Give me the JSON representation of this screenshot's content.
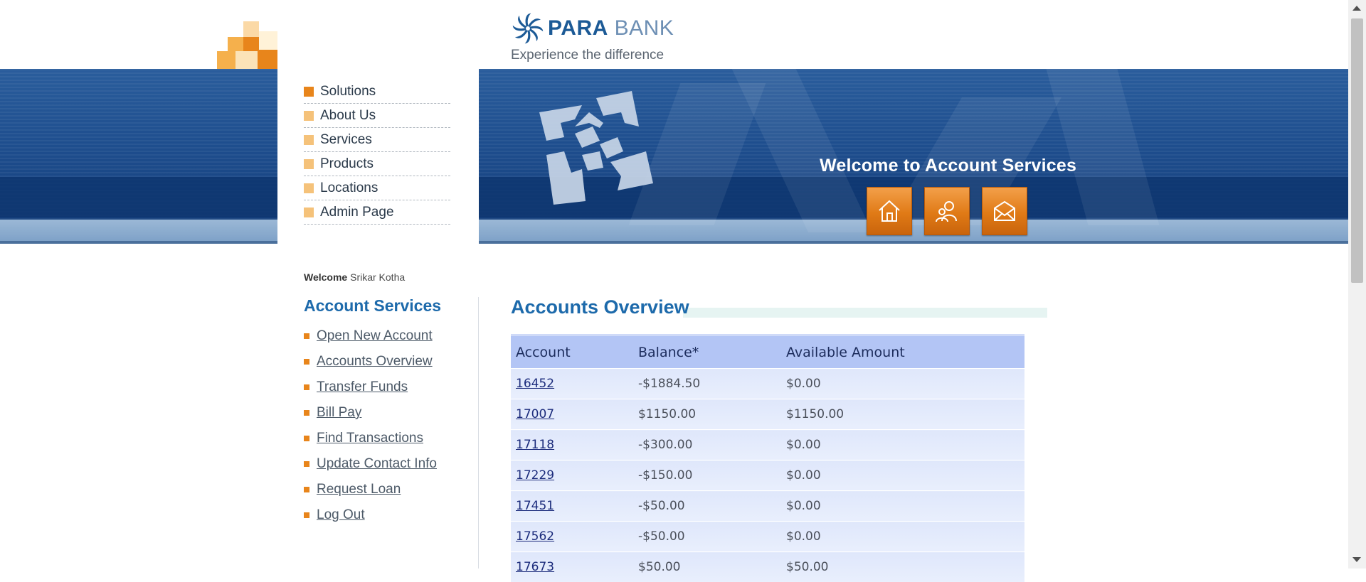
{
  "brand": {
    "name_bold": "PARA",
    "name_thin": " BANK",
    "tagline": "Experience the difference"
  },
  "top_nav": [
    {
      "label": "Solutions",
      "active": true
    },
    {
      "label": "About Us",
      "active": false
    },
    {
      "label": "Services",
      "active": false
    },
    {
      "label": "Products",
      "active": false
    },
    {
      "label": "Locations",
      "active": false
    },
    {
      "label": "Admin Page",
      "active": false
    }
  ],
  "header": {
    "welcome_title": "Welcome to Account Services",
    "buttons": [
      {
        "icon": "home-icon"
      },
      {
        "icon": "about-people-icon"
      },
      {
        "icon": "contact-envelope-icon"
      }
    ]
  },
  "sidebar": {
    "welcome_label": "Welcome",
    "user_name": "Srikar Kotha",
    "title": "Account Services",
    "links": [
      "Open New Account",
      "Accounts Overview",
      "Transfer Funds",
      "Bill Pay",
      "Find Transactions",
      "Update Contact Info",
      "Request Loan",
      "Log Out"
    ]
  },
  "main": {
    "title": "Accounts Overview",
    "table": {
      "headers": [
        "Account",
        "Balance*",
        "Available Amount"
      ],
      "rows": [
        [
          "16452",
          "-$1884.50",
          "$0.00"
        ],
        [
          "17007",
          "$1150.00",
          "$1150.00"
        ],
        [
          "17118",
          "-$300.00",
          "$0.00"
        ],
        [
          "17229",
          "-$150.00",
          "$0.00"
        ],
        [
          "17451",
          "-$50.00",
          "$0.00"
        ],
        [
          "17562",
          "-$50.00",
          "$0.00"
        ],
        [
          "17673",
          "$50.00",
          "$50.00"
        ]
      ]
    }
  },
  "colors": {
    "accent_orange": "#e8851b",
    "header_blue": "#1f4f8f",
    "title_blue": "#1d6aab",
    "table_header": "#b3c5f5"
  }
}
